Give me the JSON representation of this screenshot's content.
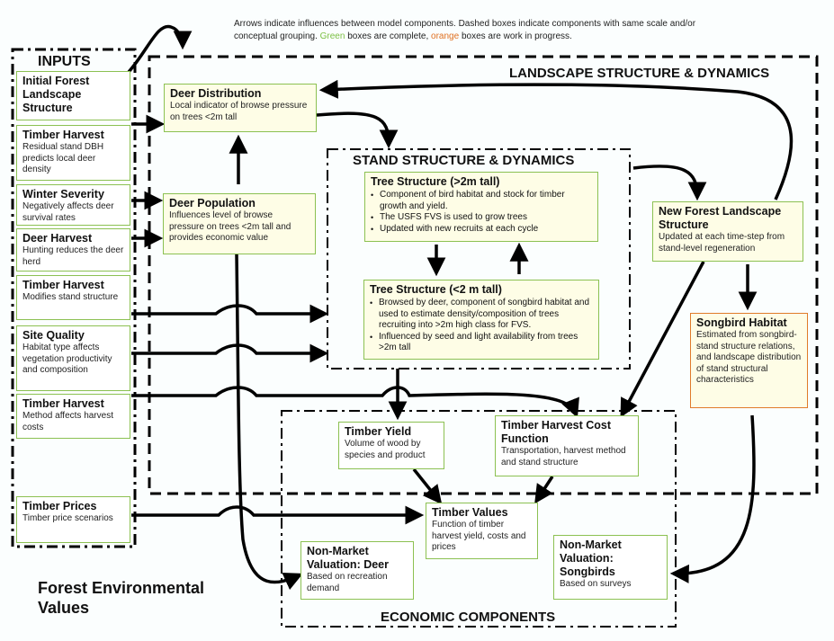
{
  "legend_note": {
    "line1": "Arrows indicate influences between model components. Dashed boxes indicate components with same scale and/or",
    "line2_prefix": "conceptual grouping. ",
    "green_word": "Green",
    "middle": " boxes are complete, ",
    "orange_word": "orange",
    "suffix": " boxes are work in progress."
  },
  "colors": {
    "complete": "#8cc152",
    "in_progress": "#e07b2a"
  },
  "groups": {
    "inputs": "INPUTS",
    "landscape": "LANDSCAPE STRUCTURE & DYNAMICS",
    "stand": "STAND STRUCTURE & DYNAMICS",
    "economic": "ECONOMIC COMPONENTS"
  },
  "inputs": [
    {
      "title": "Initial Forest Landscape Structure",
      "desc": ""
    },
    {
      "title": "Timber Harvest",
      "desc": "Residual stand DBH predicts local deer density"
    },
    {
      "title": "Winter Severity",
      "desc": "Negatively affects deer survival rates"
    },
    {
      "title": "Deer Harvest",
      "desc": "Hunting reduces the deer herd"
    },
    {
      "title": "Timber Harvest",
      "desc": "Modifies stand structure"
    },
    {
      "title": "Site Quality",
      "desc": "Habitat type affects vegetation productivity and composition"
    },
    {
      "title": "Timber Harvest",
      "desc": "Method affects harvest costs"
    },
    {
      "title": "Timber Prices",
      "desc": "Timber price scenarios"
    }
  ],
  "landscape": {
    "deer_distribution": {
      "title": "Deer Distribution",
      "desc": "Local indicator of browse pressure on trees <2m tall"
    },
    "deer_population": {
      "title": "Deer Population",
      "desc": "Influences level of browse pressure on trees <2m tall and provides economic value"
    },
    "new_forest": {
      "title": "New Forest Landscape Structure",
      "desc": "Updated at each time-step from stand-level regeneration"
    },
    "songbird_habitat": {
      "title": "Songbird Habitat",
      "desc": "Estimated from songbird-stand structure relations, and landscape distribution of stand structural characteristics",
      "status": "in progress"
    }
  },
  "stand": {
    "tree_tall": {
      "title": "Tree Structure (>2m tall)",
      "bullets": [
        "Component of bird habitat and stock for timber growth and yield.",
        "The USFS FVS is used to grow trees",
        "Updated with new recruits at each cycle"
      ]
    },
    "tree_short": {
      "title": "Tree Structure (<2 m tall)",
      "bullets": [
        "Browsed by deer, component of songbird habitat and used to estimate density/composition of trees recruiting into >2m high class for FVS.",
        "Influenced by seed and light availability from trees >2m tall"
      ]
    }
  },
  "economic": {
    "timber_yield": {
      "title": "Timber Yield",
      "desc": "Volume of wood by species and product"
    },
    "harvest_cost": {
      "title": "Timber Harvest Cost Function",
      "desc": "Transportation, harvest method and stand structure"
    },
    "timber_values": {
      "title": "Timber Values",
      "desc": "Function of timber harvest yield, costs and prices"
    },
    "nm_deer": {
      "title": "Non-Market Valuation: Deer",
      "desc": "Based on recreation demand"
    },
    "nm_songbirds": {
      "title": "Non-Market Valuation: Songbirds",
      "desc": "Based on surveys"
    }
  },
  "footer_title": "Forest Environmental Values"
}
